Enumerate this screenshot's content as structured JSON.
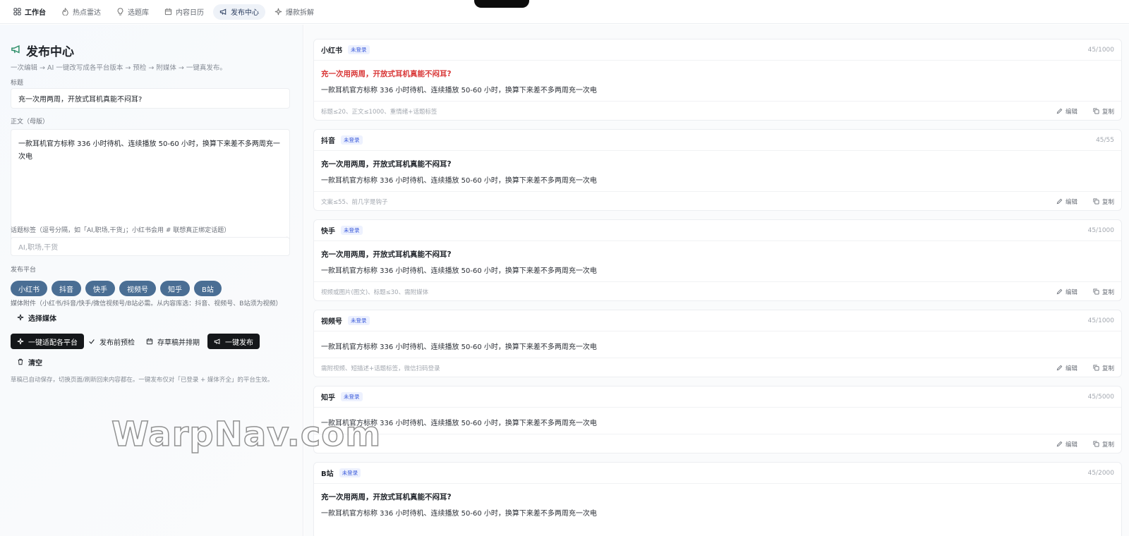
{
  "nav": {
    "tabs": [
      {
        "label": "工作台",
        "icon": "grid-icon"
      },
      {
        "label": "热点雷达",
        "icon": "flame-icon"
      },
      {
        "label": "选题库",
        "icon": "lightbulb-icon"
      },
      {
        "label": "内容日历",
        "icon": "calendar-icon"
      },
      {
        "label": "发布中心",
        "icon": "megaphone-icon"
      },
      {
        "label": "爆款拆解",
        "icon": "sparkle-icon"
      }
    ],
    "active": "发布中心"
  },
  "editor": {
    "title": "发布中心",
    "subtitle": "一次编辑 → AI 一键改写成各平台版本 → 预检 → 附媒体 → 一键真发布。",
    "title_label": "标题",
    "title_value": "充一次用两周，开放式耳机真能不闷耳?",
    "body_label": "正文（母版）",
    "body_value": "一款耳机官方标称 336 小时待机、连续播放 50-60 小时，换算下来差不多两周充一次电",
    "tags_label": "话题标签（逗号分隔，如「AI,职场,干货」；小红书会用 # 联想真正绑定话题）",
    "tags_placeholder": "AI,职场,干货",
    "platform_label": "发布平台",
    "platforms": [
      "小红书",
      "抖音",
      "快手",
      "视频号",
      "知乎",
      "B站"
    ],
    "media_label": "媒体附件（小红书/抖音/快手/微信视频号/B站必需。从内容库选：抖音、视频号、B站须为视频）",
    "select_media": "选择媒体",
    "buttons": {
      "adapt": "一键适配各平台",
      "precheck": "发布前预检",
      "schedule": "存草稿并排期",
      "publish": "一键发布",
      "clear": "清空"
    },
    "note": "草稿已自动保存，切换页面/刷新回来内容都在。一键发布仅对「已登录 + 媒体齐全」的平台生效。"
  },
  "cards": [
    {
      "name": "小红书",
      "badge": "未登录",
      "count": "45/1000",
      "title": "充一次用两周，开放式耳机真能不闷耳?",
      "title_red": true,
      "body": "一款耳机官方标称 336 小时待机、连续播放 50-60 小时，换算下来差不多两周充一次电",
      "hint": "标题≤20、正文≤1000、重情绪+话题标签",
      "edit": "编辑",
      "copy": "复制"
    },
    {
      "name": "抖音",
      "badge": "未登录",
      "count": "45/55",
      "title": "充一次用两周，开放式耳机真能不闷耳?",
      "title_red": false,
      "body": "一款耳机官方标称 336 小时待机、连续播放 50-60 小时，换算下来差不多两周充一次电",
      "hint": "文案≤55、前几字是钩子",
      "edit": "编辑",
      "copy": "复制"
    },
    {
      "name": "快手",
      "badge": "未登录",
      "count": "45/1000",
      "title": "充一次用两周，开放式耳机真能不闷耳?",
      "title_red": false,
      "body": "一款耳机官方标称 336 小时待机、连续播放 50-60 小时，换算下来差不多两周充一次电",
      "hint": "视频或图片(图文)、标题≤30、需附媒体",
      "edit": "编辑",
      "copy": "复制"
    },
    {
      "name": "视频号",
      "badge": "未登录",
      "count": "45/1000",
      "title": "",
      "title_red": false,
      "body": "一款耳机官方标称 336 小时待机、连续播放 50-60 小时，换算下来差不多两周充一次电",
      "hint": "需附视频、短描述+话题标签，微信扫码登录",
      "edit": "编辑",
      "copy": "复制"
    },
    {
      "name": "知乎",
      "badge": "未登录",
      "count": "45/5000",
      "title": "",
      "title_red": false,
      "body": "一款耳机官方标称 336 小时待机、连续播放 50-60 小时，换算下来差不多两周充一次电",
      "hint": "",
      "edit": "编辑",
      "copy": "复制"
    },
    {
      "name": "B站",
      "badge": "未登录",
      "count": "45/2000",
      "title": "充一次用两周，开放式耳机真能不闷耳?",
      "title_red": false,
      "body": "一款耳机官方标称 336 小时待机、连续播放 50-60 小时，换算下来差不多两周充一次电",
      "hint": "",
      "edit": "编辑",
      "copy": "复制"
    }
  ],
  "watermark": "WarpNav.com"
}
